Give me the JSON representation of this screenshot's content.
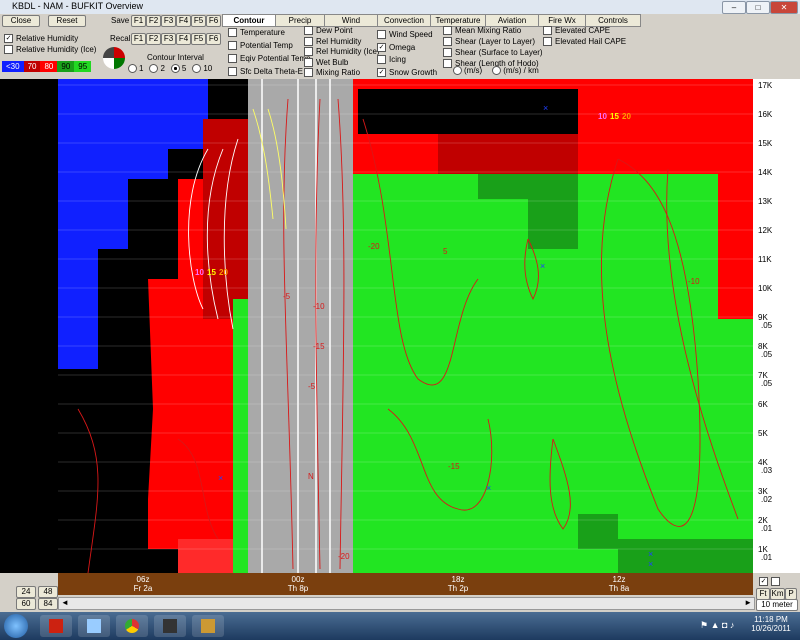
{
  "window": {
    "title": "KBDL - NAM - BUFKIT Overview"
  },
  "toolbar": {
    "close_label": "Close",
    "reset_label": "Reset",
    "save_label": "Save",
    "recall_label": "Recall",
    "f_keys": [
      "F1",
      "F2",
      "F3",
      "F4",
      "F5",
      "F6"
    ],
    "rh_label": "Relative Humidity",
    "rh_ice_label": "Relative Humidity (Ice)",
    "contour_interval_label": "Contour Interval",
    "contour_options": [
      "1",
      "2",
      "5",
      "10"
    ],
    "contour_selected": "5",
    "legend": [
      {
        "label": "<30",
        "color": "#1020ff"
      },
      {
        "label": "70",
        "color": "#c00000"
      },
      {
        "label": "80",
        "color": "#ff0000"
      },
      {
        "label": "90",
        "color": "#19a019"
      },
      {
        "label": "95",
        "color": "#22d822"
      }
    ]
  },
  "tabs": [
    "Contour",
    "Precip",
    "Wind",
    "Convection",
    "Temperature",
    "Aviation",
    "Fire Wx",
    "Controls"
  ],
  "active_tab": "Contour",
  "options": {
    "col1": [
      {
        "label": "Temperature",
        "checked": false
      },
      {
        "label": "Potential Temp",
        "checked": false
      },
      {
        "label": "Eqiv Potential Temp",
        "checked": false
      },
      {
        "label": "Sfc Delta Theta-E",
        "checked": false
      }
    ],
    "col2": [
      {
        "label": "Dew Point",
        "checked": false
      },
      {
        "label": "Rel Humidity",
        "checked": false
      },
      {
        "label": "Rel Humidity (Ice)",
        "checked": false
      },
      {
        "label": "Wet Bulb",
        "checked": false
      },
      {
        "label": "Mixing Ratio",
        "checked": false
      }
    ],
    "col3": [
      {
        "label": "Wind Speed",
        "checked": false
      },
      {
        "label": "Omega",
        "checked": true
      },
      {
        "label": "Icing",
        "checked": false
      },
      {
        "label": "Snow Growth",
        "checked": true
      }
    ],
    "col4": [
      {
        "label": "Mean Mixing Ratio",
        "checked": false
      },
      {
        "label": "Shear (Layer to Layer)",
        "checked": false
      },
      {
        "label": "Shear (Surface to Layer)",
        "checked": false
      },
      {
        "label": "Shear (Length of Hodo)",
        "checked": false
      }
    ],
    "col5": [
      {
        "label": "Elevated CAPE",
        "checked": false
      },
      {
        "label": "Elevated Hail CAPE",
        "checked": false
      }
    ],
    "units": [
      "(m/s)",
      "(m/s) / km"
    ]
  },
  "axis": {
    "heights": [
      "17K",
      "16K",
      "15K",
      "14K",
      "13K",
      "12K",
      "11K",
      "10K",
      "9K",
      "8K",
      "7K",
      "6K",
      "5K",
      "4K",
      "3K",
      "2K",
      "1K"
    ],
    "fractions": [
      "",
      "",
      "",
      "",
      "",
      "",
      "",
      "",
      ".05",
      ".05",
      ".05",
      "",
      "",
      ".03",
      ".02",
      ".01",
      ".01"
    ]
  },
  "plot_labels": [
    {
      "text": "10",
      "color": "#ff6cff"
    },
    {
      "text": "15",
      "color": "#ffff00"
    },
    {
      "text": "20",
      "color": "#ffa000"
    }
  ],
  "contour_labels": [
    "-5",
    "-10",
    "-15",
    "-20",
    "5",
    "N",
    "-5",
    "-10",
    "-15",
    "-20"
  ],
  "timeline": [
    {
      "time": "06z",
      "day": "Fr 2a"
    },
    {
      "time": "00z",
      "day": "Th 8p"
    },
    {
      "time": "18z",
      "day": "Th 2p"
    },
    {
      "time": "12z",
      "day": "Th 8a"
    }
  ],
  "range_buttons": [
    [
      "24",
      "48"
    ],
    [
      "60",
      "84"
    ]
  ],
  "bottom_right": {
    "ft": "Ft",
    "km": "Km",
    "p": "P",
    "meter": "10 meter"
  },
  "clock": {
    "time": "11:18 PM",
    "date": "10/26/2011"
  }
}
